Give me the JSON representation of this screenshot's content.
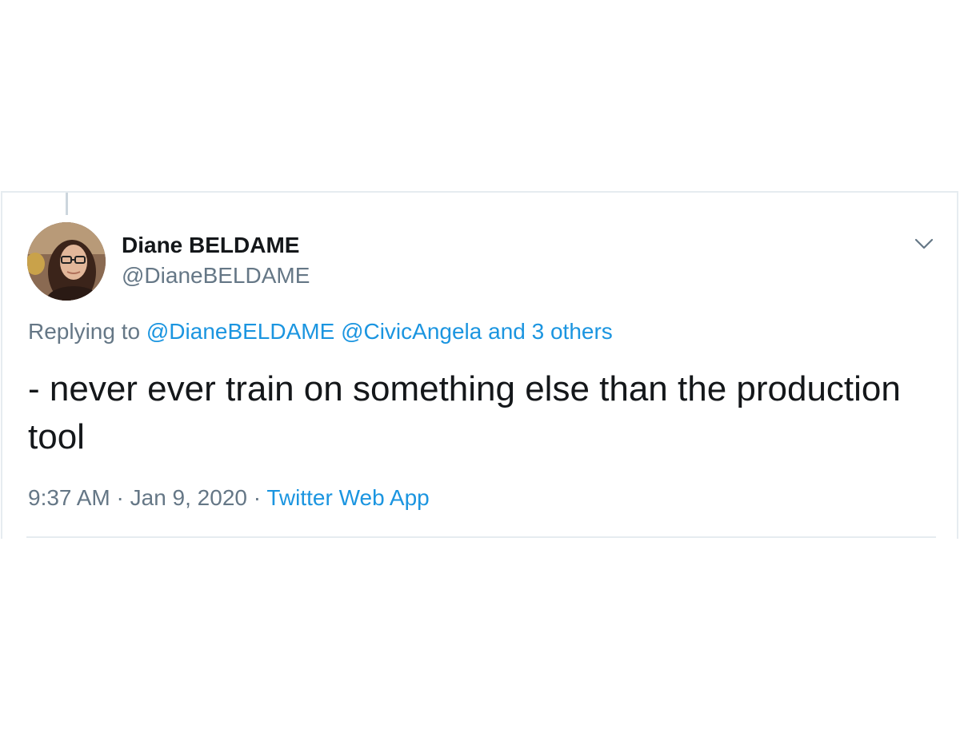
{
  "tweet": {
    "author": {
      "display_name": "Diane BELDAME",
      "handle": "@DianeBELDAME"
    },
    "menu_icon": "chevron-down-icon",
    "reply": {
      "prefix": "Replying to",
      "mention_1": "@DianeBELDAME",
      "mention_2": "@CivicAngela",
      "others": "and 3 others"
    },
    "text": "- never ever train on something else than the production tool",
    "meta": {
      "time": "9:37 AM",
      "separator": "·",
      "date": "Jan 9, 2020",
      "source": "Twitter Web App"
    }
  },
  "colors": {
    "text_primary": "#14171a",
    "text_secondary": "#657786",
    "link": "#1b95e0",
    "border": "#e6ecf0"
  }
}
